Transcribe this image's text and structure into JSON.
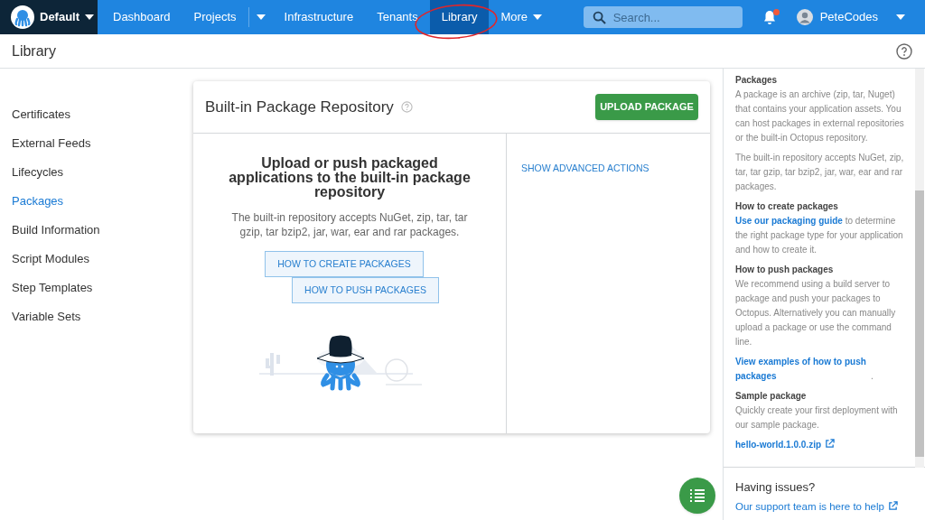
{
  "space": {
    "name": "Default"
  },
  "nav": [
    {
      "label": "Dashboard",
      "selected": false,
      "kind": "link"
    },
    {
      "label": "Projects",
      "selected": false,
      "kind": "split"
    },
    {
      "label": "Infrastructure",
      "selected": false,
      "kind": "link"
    },
    {
      "label": "Tenants",
      "selected": false,
      "kind": "link"
    },
    {
      "label": "Library",
      "selected": true,
      "kind": "link"
    },
    {
      "label": "More",
      "selected": false,
      "kind": "menu"
    }
  ],
  "search": {
    "placeholder": "Search..."
  },
  "notifications": {
    "unread": true
  },
  "user": {
    "name": "PeteCodes"
  },
  "page_title": "Library",
  "sidebar": {
    "items": [
      {
        "label": "Certificates",
        "selected": false
      },
      {
        "label": "External Feeds",
        "selected": false
      },
      {
        "label": "Lifecycles",
        "selected": false
      },
      {
        "label": "Packages",
        "selected": true
      },
      {
        "label": "Build Information",
        "selected": false
      },
      {
        "label": "Script Modules",
        "selected": false
      },
      {
        "label": "Step Templates",
        "selected": false
      },
      {
        "label": "Variable Sets",
        "selected": false
      }
    ]
  },
  "card": {
    "title": "Built-in Package Repository",
    "primary_button": "UPLOAD PACKAGE",
    "heading": "Upload or push packaged applications to the built-in package repository",
    "description": "The built-in repository accepts NuGet, zip, tar, tar gzip, tar bzip2, jar, war, ear and rar packages.",
    "buttons": [
      "HOW TO CREATE PACKAGES",
      "HOW TO PUSH PACKAGES"
    ],
    "advanced_link": "SHOW ADVANCED ACTIONS"
  },
  "help": {
    "sections": [
      {
        "title": "Packages",
        "paragraphs": [
          [
            {
              "kind": "text",
              "text": "A package is an archive (zip, tar, Nuget) that contains your application assets. You can host packages in external repositories or the built-in Octopus repository."
            }
          ],
          [
            {
              "kind": "text",
              "text": "The built-in repository accepts NuGet, zip, tar, tar gzip, tar bzip2, jar, war, ear and rar packages."
            }
          ]
        ]
      },
      {
        "title": "How to create packages",
        "paragraphs": [
          [
            {
              "kind": "link",
              "text": "Use our packaging guide"
            },
            {
              "kind": "text",
              "text": " to determine the right package type for your application and how to create it."
            }
          ]
        ]
      },
      {
        "title": "How to push packages",
        "paragraphs": [
          [
            {
              "kind": "text",
              "text": "We recommend using a build server to package and push your packages to Octopus. Alternatively you can manually upload a package or use the command line."
            }
          ],
          [
            {
              "kind": "link",
              "text": "View examples of how to push packages"
            },
            {
              "kind": "text",
              "text": "."
            }
          ]
        ]
      },
      {
        "title": "Sample package",
        "paragraphs": [
          [
            {
              "kind": "text",
              "text": "Quickly create your first deployment with our sample package."
            }
          ],
          [
            {
              "kind": "external",
              "text": "hello-world.1.0.0.zip"
            }
          ]
        ]
      }
    ],
    "issues_title": "Having issues?",
    "issues_link": "Our support team is here to help"
  }
}
